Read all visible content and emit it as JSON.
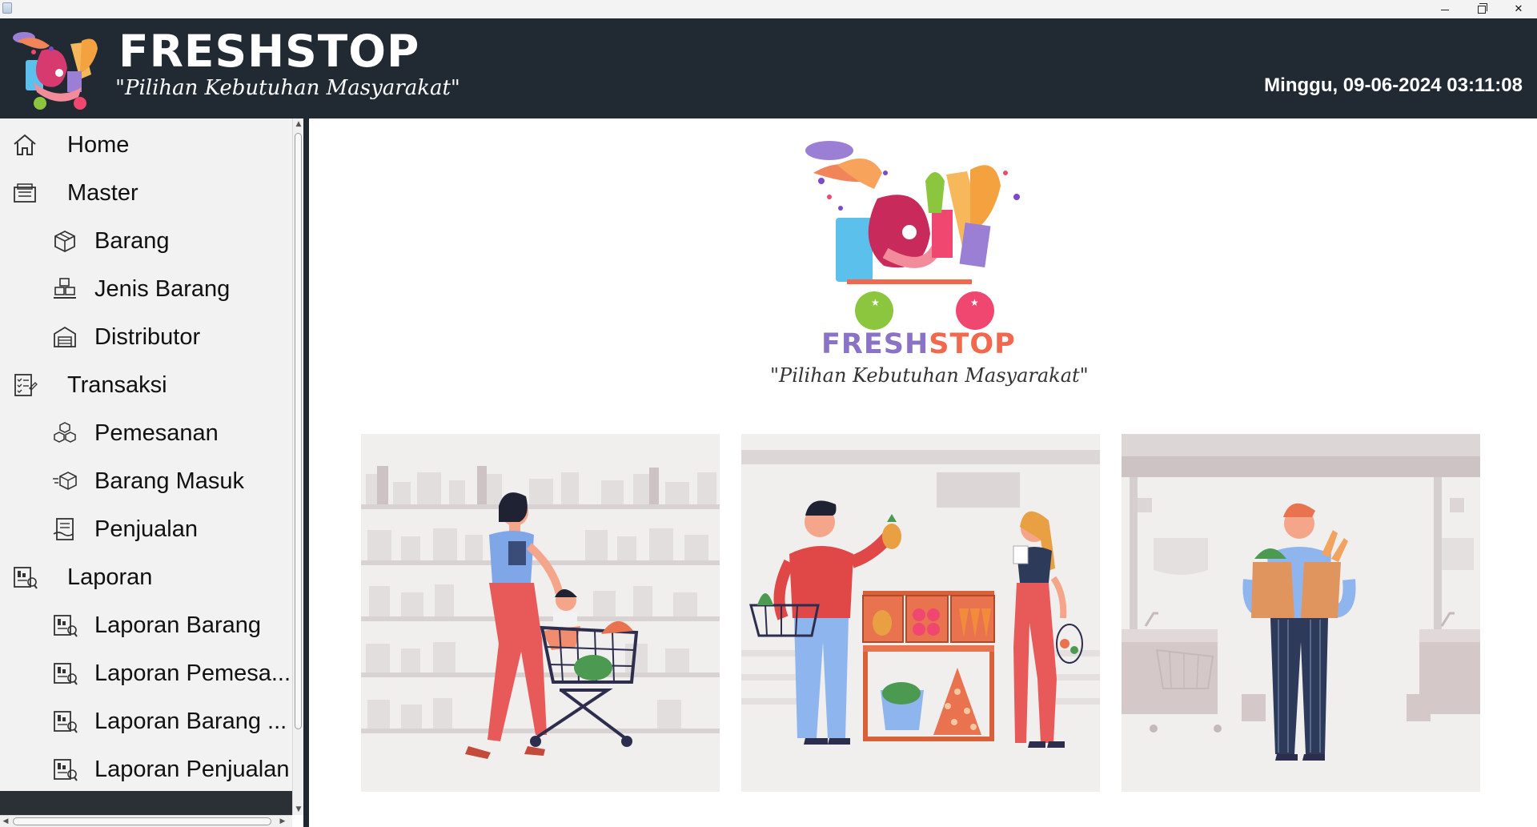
{
  "window": {
    "minimize": "–",
    "maximize": "❐",
    "close": "✕"
  },
  "header": {
    "brand": "FRESHSTOP",
    "tagline": "\"Pilihan Kebutuhan Masyarakat\"",
    "datetime": "Minggu, 09-06-2024 03:11:08"
  },
  "sidebar": {
    "items": [
      {
        "label": "Home",
        "icon": "home-icon",
        "level": 0
      },
      {
        "label": "Master",
        "icon": "folder-icon",
        "level": 0
      },
      {
        "label": "Barang",
        "icon": "box-icon",
        "level": 1
      },
      {
        "label": "Jenis Barang",
        "icon": "boxes-icon",
        "level": 1
      },
      {
        "label": "Distributor",
        "icon": "warehouse-icon",
        "level": 1
      },
      {
        "label": "Transaksi",
        "icon": "checklist-icon",
        "level": 0
      },
      {
        "label": "Pemesanan",
        "icon": "cubes-icon",
        "level": 1
      },
      {
        "label": "Barang Masuk",
        "icon": "incoming-box-icon",
        "level": 1
      },
      {
        "label": "Penjualan",
        "icon": "sales-icon",
        "level": 1
      },
      {
        "label": "Laporan",
        "icon": "report-icon",
        "level": 0
      },
      {
        "label": "Laporan Barang",
        "icon": "report-icon",
        "level": 1
      },
      {
        "label": "Laporan Pemesa...",
        "icon": "report-icon",
        "level": 1
      },
      {
        "label": "Laporan Barang ...",
        "icon": "report-icon",
        "level": 1
      },
      {
        "label": "Laporan Penjualan",
        "icon": "report-icon",
        "level": 1
      }
    ]
  },
  "main": {
    "brand_part1": "FRESH",
    "brand_part2": "STOP",
    "tagline": "\"Pilihan Kebutuhan Masyarakat\"",
    "illustrations": [
      "shopping-with-cart-illustration",
      "buying-fruit-illustration",
      "carrying-groceries-illustration"
    ]
  },
  "colors": {
    "header_bg": "#212a33",
    "sidebar_bg": "#f2f2f2",
    "brand_purple": "#8a73c6",
    "brand_orange": "#f2684d"
  }
}
